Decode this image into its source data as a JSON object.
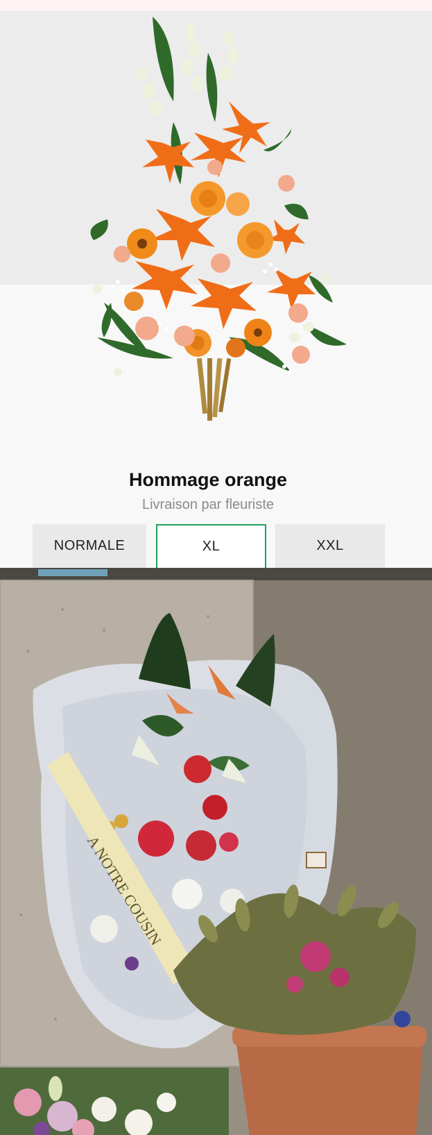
{
  "product": {
    "image_alt": "Composition florale orange",
    "title": "Hommage orange",
    "subtitle": "Livraison par fleuriste"
  },
  "sizes": [
    {
      "label": "NORMALE",
      "selected": false
    },
    {
      "label": "XL",
      "selected": true
    },
    {
      "label": "XXL",
      "selected": false
    }
  ],
  "gallery": {
    "image_alt": "Photo de livraison au cimetière",
    "ribbon_text": "A NOTRE COUSIN"
  },
  "colors": {
    "accent": "#1fa05a",
    "flower_orange": "#f07a1c",
    "card_bg": "#f8f8f8"
  }
}
